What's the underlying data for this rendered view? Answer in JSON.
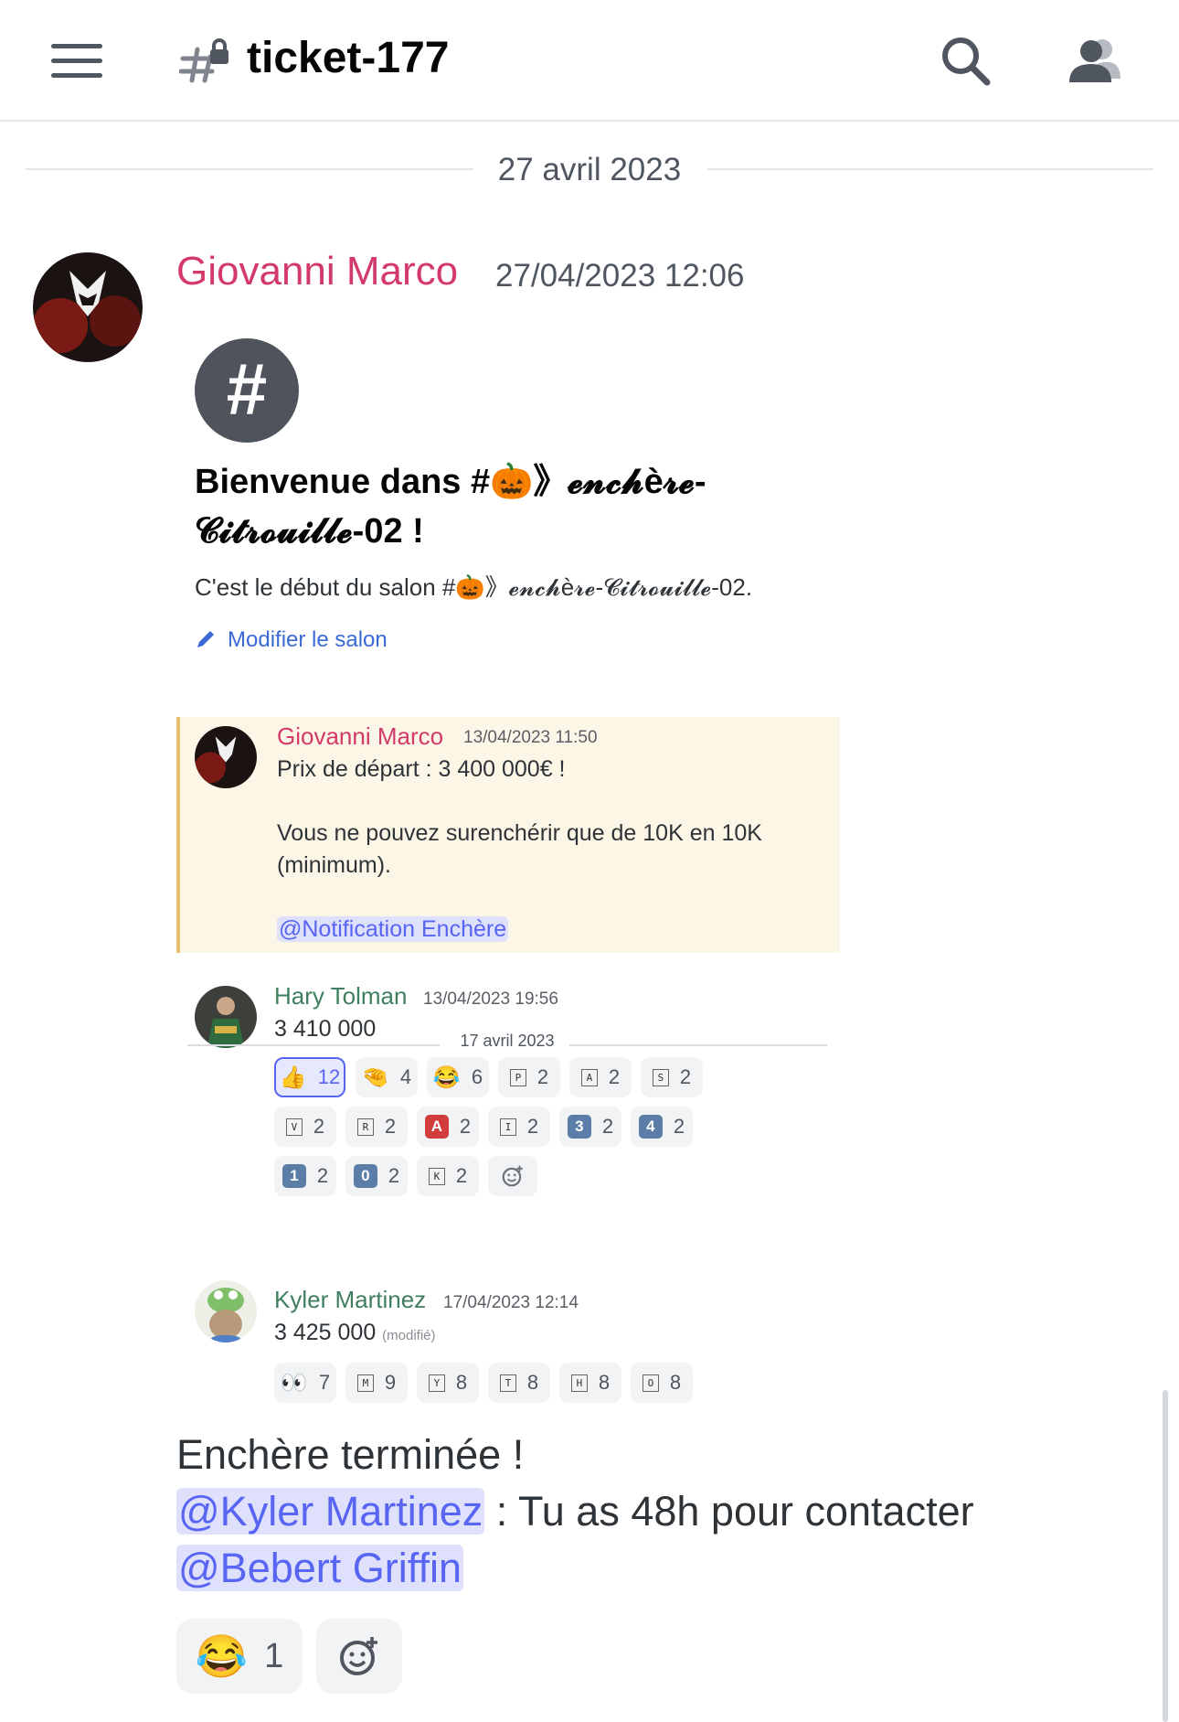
{
  "header": {
    "channel_name": "ticket-177"
  },
  "date_divider": "27 avril 2023",
  "message": {
    "author": "Giovanni Marco",
    "timestamp": "27/04/2023 12:06",
    "author_color": "#d33a6a",
    "text_line1": "Enchère terminée !",
    "mention1": "@Kyler Martinez",
    "text_mid": " : Tu as 48h pour contacter",
    "mention2": "@Bebert Griffin",
    "reaction": {
      "emoji": "😂",
      "count": "1"
    }
  },
  "embedded_screenshot": {
    "welcome_title_a": "Bienvenue dans #🎃》𝓮𝓷𝓬𝓱è𝓻𝓮-",
    "welcome_title_b": "𝓒𝓲𝓽𝓻𝓸𝓾𝓲𝓵𝓵𝓮-02 !",
    "welcome_sub": "C'est le début du salon #🎃》𝓮𝓷𝓬𝓱è𝓻𝓮-𝓒𝓲𝓽𝓻𝓸𝓾𝓲𝓵𝓵𝓮-02.",
    "edit_label": "Modifier le salon",
    "quoted": {
      "author": "Giovanni Marco",
      "timestamp": "13/04/2023 11:50",
      "line1": "Prix de départ : 3 400 000€ !",
      "line2": "Vous ne pouvez surenchérir que de 10K en 10K",
      "line3": "(minimum).",
      "mention": "@Notification Enchère"
    },
    "msg2": {
      "author": "Hary Tolman",
      "timestamp": "13/04/2023 19:56",
      "text": "3 410 000",
      "reactions": [
        {
          "kind": "emoji",
          "emoji": "👍",
          "count": "12",
          "selected": true
        },
        {
          "kind": "emoji",
          "emoji": "🤏",
          "count": "4"
        },
        {
          "kind": "emoji",
          "emoji": "😂",
          "count": "6"
        },
        {
          "kind": "letter",
          "emoji": "P",
          "count": "2"
        },
        {
          "kind": "letter",
          "emoji": "A",
          "count": "2"
        },
        {
          "kind": "letter",
          "emoji": "S",
          "count": "2"
        },
        {
          "kind": "letter",
          "emoji": "V",
          "count": "2"
        },
        {
          "kind": "letter",
          "emoji": "R",
          "count": "2"
        },
        {
          "kind": "keycap-red",
          "emoji": "A",
          "count": "2"
        },
        {
          "kind": "letter",
          "emoji": "I",
          "count": "2"
        },
        {
          "kind": "keycap",
          "emoji": "3",
          "count": "2"
        },
        {
          "kind": "keycap",
          "emoji": "4",
          "count": "2"
        },
        {
          "kind": "keycap",
          "emoji": "1",
          "count": "2"
        },
        {
          "kind": "keycap",
          "emoji": "0",
          "count": "2"
        },
        {
          "kind": "letter",
          "emoji": "K",
          "count": "2"
        }
      ]
    },
    "date_divider": "17 avril 2023",
    "msg3": {
      "author": "Kyler Martinez",
      "timestamp": "17/04/2023 12:14",
      "text": "3 425 000",
      "edited": "(modifié)",
      "reactions": [
        {
          "kind": "emoji",
          "emoji": "👀",
          "count": "7"
        },
        {
          "kind": "letter",
          "emoji": "M",
          "count": "9"
        },
        {
          "kind": "letter",
          "emoji": "Y",
          "count": "8"
        },
        {
          "kind": "letter",
          "emoji": "T",
          "count": "8"
        },
        {
          "kind": "letter",
          "emoji": "H",
          "count": "8"
        },
        {
          "kind": "letter",
          "emoji": "O",
          "count": "8"
        }
      ]
    },
    "colors": {
      "green_author": "#3f7f5f",
      "mention_bg": "#dee0fc",
      "mention_fg": "#5865f2"
    }
  }
}
